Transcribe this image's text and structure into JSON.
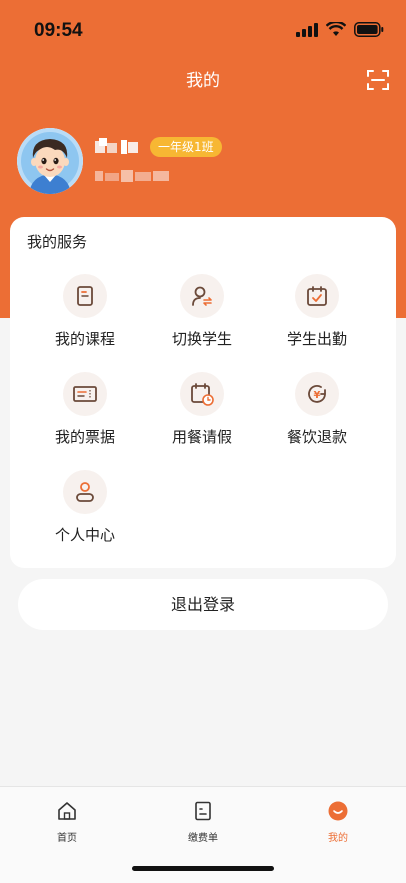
{
  "status_bar": {
    "time": "09:54"
  },
  "header": {
    "title": "我的"
  },
  "profile": {
    "name": "**",
    "class_badge": "一年级1班",
    "phone": "****"
  },
  "services": {
    "title": "我的服务",
    "items": [
      {
        "label": "我的课程",
        "icon": "book-icon"
      },
      {
        "label": "切换学生",
        "icon": "switch-user-icon"
      },
      {
        "label": "学生出勤",
        "icon": "calendar-check-icon"
      },
      {
        "label": "我的票据",
        "icon": "ticket-icon"
      },
      {
        "label": "用餐请假",
        "icon": "calendar-clock-icon"
      },
      {
        "label": "餐饮退款",
        "icon": "refund-icon"
      },
      {
        "label": "个人中心",
        "icon": "person-icon"
      }
    ]
  },
  "logout": {
    "label": "退出登录"
  },
  "tabbar": {
    "items": [
      {
        "label": "首页",
        "icon": "home-icon"
      },
      {
        "label": "缴费单",
        "icon": "bill-icon"
      },
      {
        "label": "我的",
        "icon": "smile-icon"
      }
    ]
  },
  "colors": {
    "brand": "#ec6e35",
    "badge": "#f7b733",
    "icon_bg": "#f7f1ee"
  }
}
